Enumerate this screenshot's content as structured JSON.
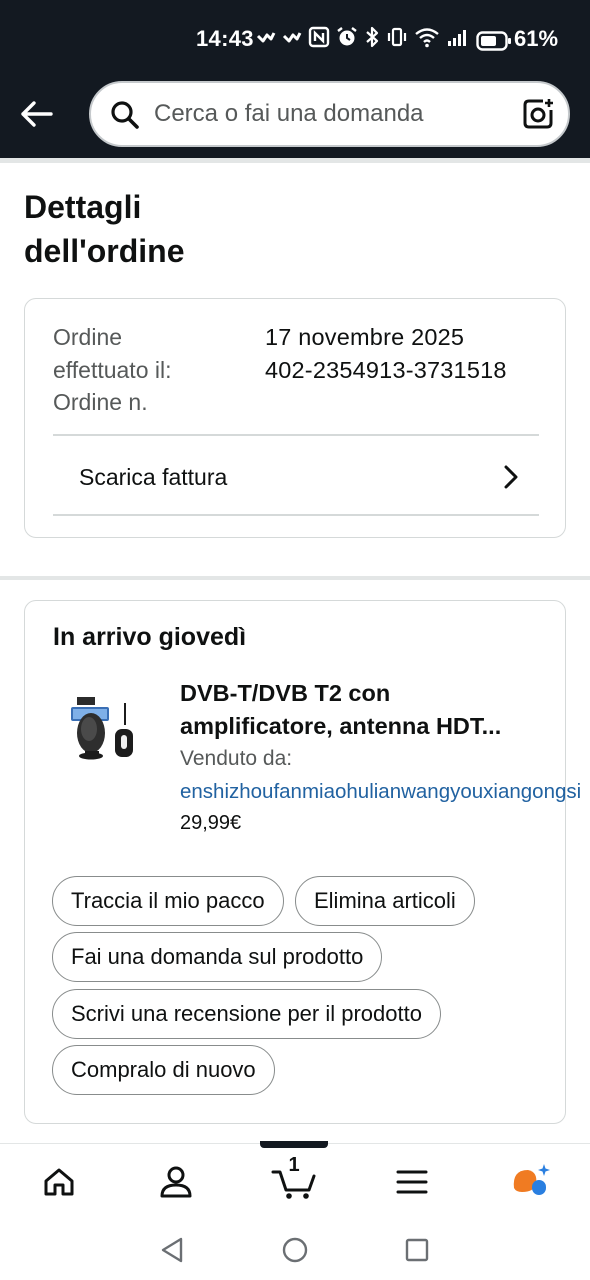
{
  "status_bar": {
    "time": "14:43",
    "battery_percent": "61%",
    "icons": [
      "hiker-app-icon",
      "hiker-app-icon",
      "nfc-icon",
      "alarm-icon",
      "bluetooth-icon",
      "vibrate-icon",
      "wifi-icon",
      "signal-icon",
      "battery-icon"
    ]
  },
  "header": {
    "back_icon": "arrow-left-icon",
    "search_placeholder": "Cerca o fai una domanda",
    "search_icon": "search-icon",
    "camera_icon": "camera-search-icon"
  },
  "page": {
    "title_line1": "Dettagli",
    "title_line2": "dell'ordine"
  },
  "order_summary": {
    "date_label_line1": "Ordine",
    "date_label_line2": "effettuato il:",
    "number_label": "Ordine n.",
    "date_value": "17 novembre 2025",
    "number_value": "402-2354913-3731518",
    "invoice_label": "Scarica fattura"
  },
  "shipment": {
    "arrival_label": "In arrivo giovedì",
    "product_title_line1": "DVB-T/DVB T2 con",
    "product_title_line2": "amplificatore, antenna HDT...",
    "sold_by_label": "Venduto da:",
    "seller_name": "enshizhoufanmiaohulianwangyouxiangongsi",
    "price": "29,99€",
    "actions": {
      "track": "Traccia il mio pacco",
      "delete": "Elimina articoli",
      "ask": "Fai una domanda sul prodotto",
      "review": "Scrivi una recensione per il prodotto",
      "buy_again": "Compralo di nuovo"
    }
  },
  "tab_bar": {
    "cart_count": "1",
    "tabs": [
      "home-icon",
      "account-icon",
      "cart-icon",
      "menu-icon",
      "rufus-ai-icon"
    ]
  },
  "system_nav": [
    "back-triangle-icon",
    "home-circle-icon",
    "recents-square-icon"
  ],
  "colors": {
    "header_bg": "#131921",
    "link": "#2162a1",
    "rufus_orange": "#f07b22",
    "rufus_blue": "#2a7fe0"
  }
}
